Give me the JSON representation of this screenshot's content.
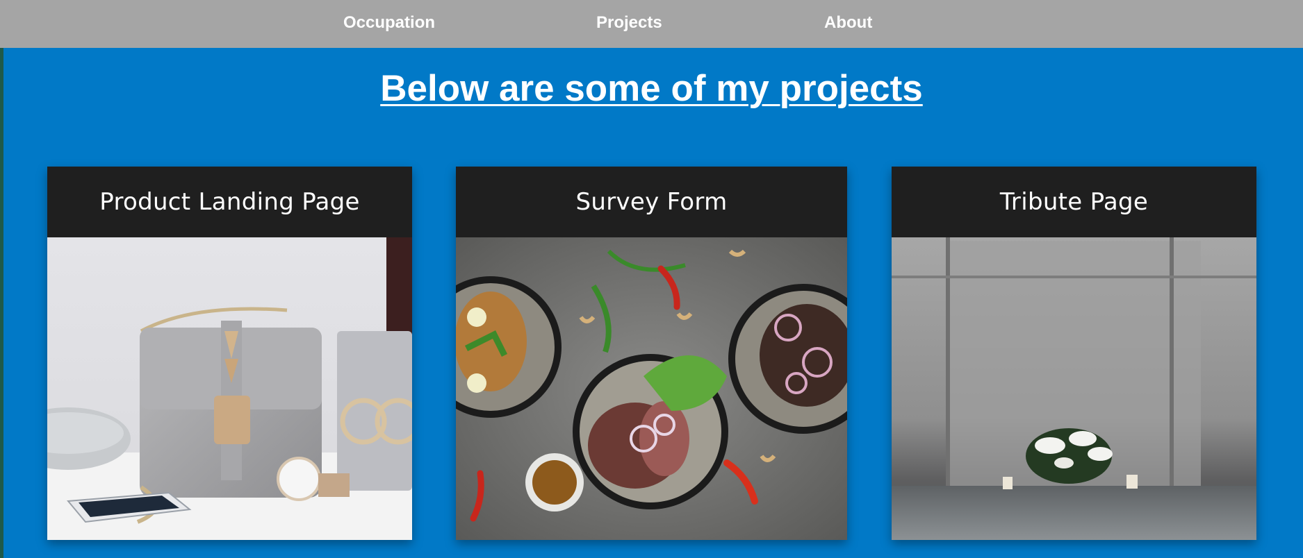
{
  "nav": {
    "links": [
      {
        "label": "Occupation"
      },
      {
        "label": "Projects"
      },
      {
        "label": "About"
      }
    ],
    "background": "#a5a5a5"
  },
  "projects_section": {
    "heading": "Below are some of my projects",
    "background": "#0179c7",
    "cards": [
      {
        "title": "Product Landing Page",
        "image": "handbag-watch-photo"
      },
      {
        "title": "Survey Form",
        "image": "food-bowls-photo"
      },
      {
        "title": "Tribute Page",
        "image": "memorial-flowers-photo"
      }
    ]
  }
}
